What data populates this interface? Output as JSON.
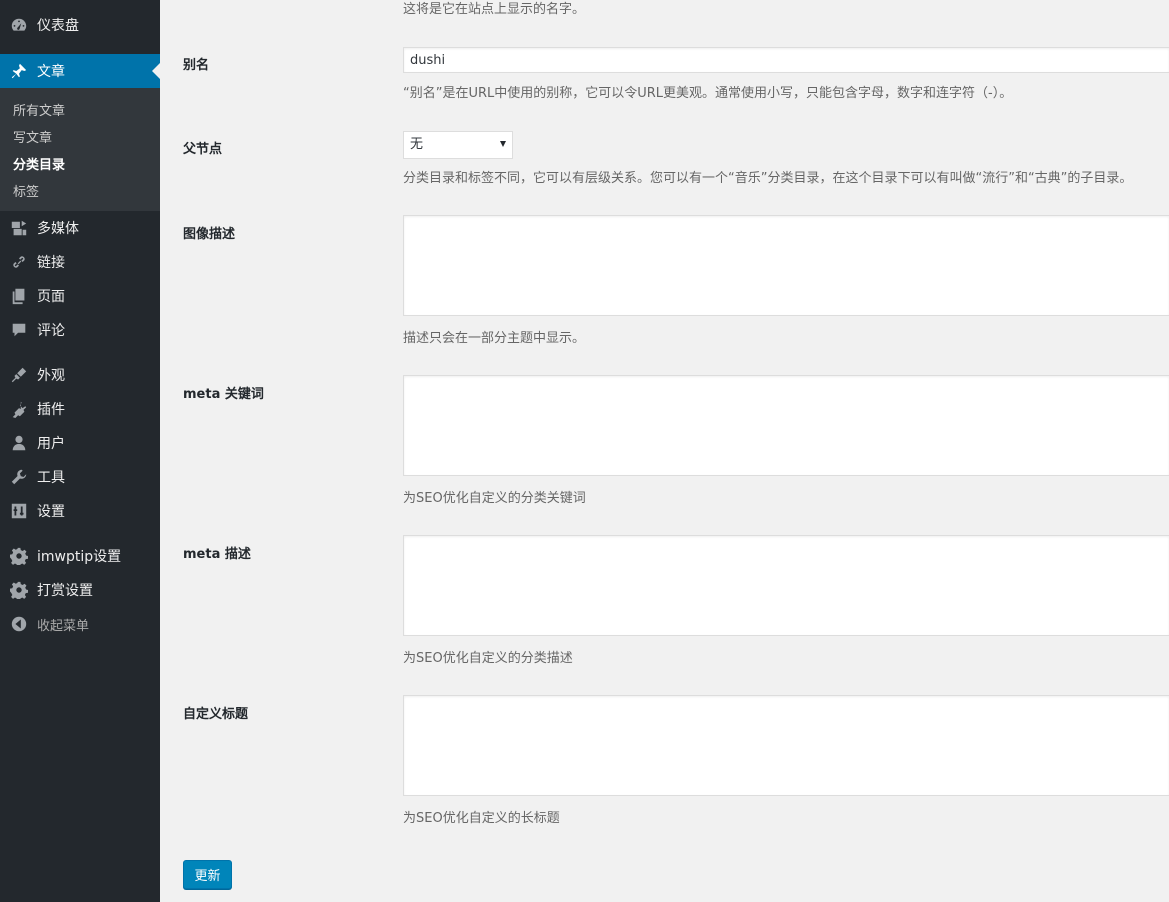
{
  "sidebar": {
    "items": [
      {
        "label": "仪表盘",
        "icon": "dashboard-icon"
      },
      {
        "label": "文章",
        "icon": "pin-icon"
      },
      {
        "label": "多媒体",
        "icon": "media-icon"
      },
      {
        "label": "链接",
        "icon": "link-icon"
      },
      {
        "label": "页面",
        "icon": "pages-icon"
      },
      {
        "label": "评论",
        "icon": "comment-icon"
      },
      {
        "label": "外观",
        "icon": "appearance-icon"
      },
      {
        "label": "插件",
        "icon": "plugin-icon"
      },
      {
        "label": "用户",
        "icon": "user-icon"
      },
      {
        "label": "工具",
        "icon": "wrench-icon"
      },
      {
        "label": "设置",
        "icon": "settings-icon"
      },
      {
        "label": "imwptip设置",
        "icon": "gear-icon"
      },
      {
        "label": "打赏设置",
        "icon": "gear-icon"
      },
      {
        "label": "收起菜单",
        "icon": "collapse-icon"
      }
    ],
    "submenu": [
      "所有文章",
      "写文章",
      "分类目录",
      "标签"
    ],
    "accent": "#0073aa"
  },
  "form": {
    "name_desc": "这将是它在站点上显示的名字。",
    "slug_label": "别名",
    "slug_value": "dushi",
    "slug_desc": "“别名”是在URL中使用的别称，它可以令URL更美观。通常使用小写，只能包含字母，数字和连字符（-）。",
    "parent_label": "父节点",
    "parent_value": "无",
    "parent_desc": "分类目录和标签不同，它可以有层级关系。您可以有一个“音乐”分类目录，在这个目录下可以有叫做“流行”和“古典”的子目录。",
    "image_desc_label": "图像描述",
    "image_desc_help": "描述只会在一部分主题中显示。",
    "meta_keywords_label": "meta 关键词",
    "meta_keywords_help": "为SEO优化自定义的分类关键词",
    "meta_desc_label": "meta 描述",
    "meta_desc_help": "为SEO优化自定义的分类描述",
    "custom_title_label": "自定义标题",
    "custom_title_help": "为SEO优化自定义的长标题",
    "submit_label": "更新"
  }
}
